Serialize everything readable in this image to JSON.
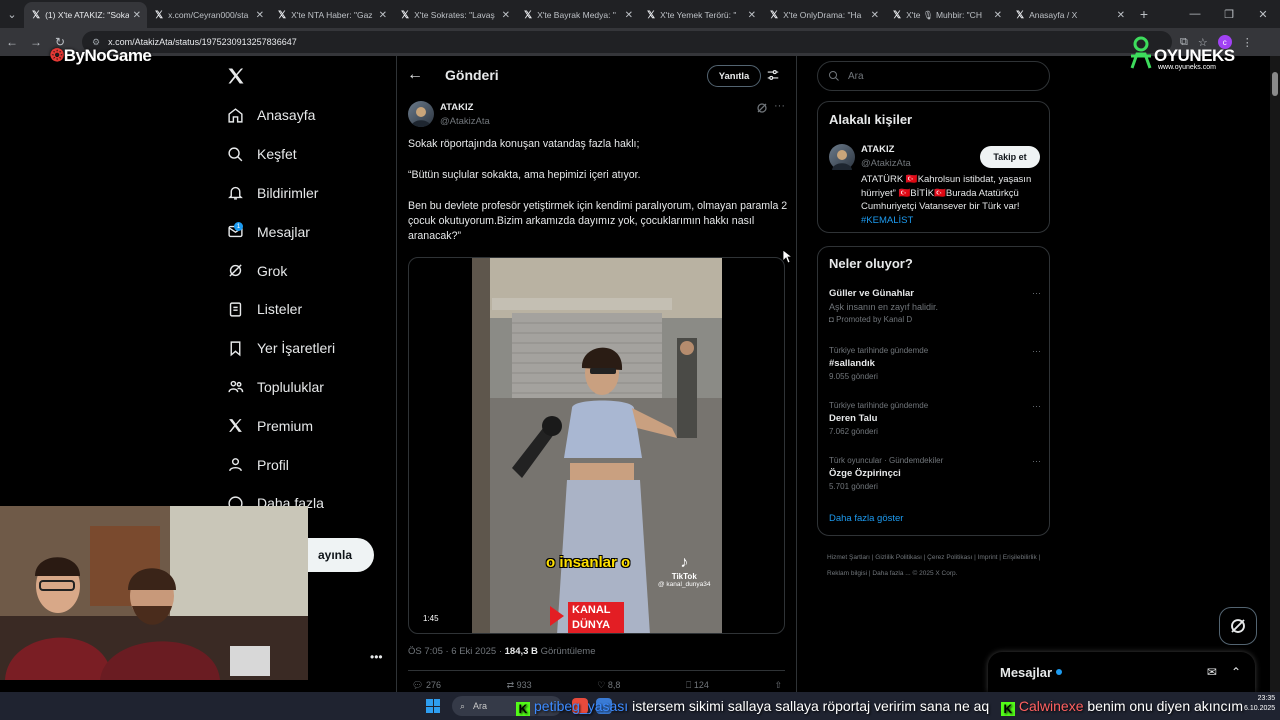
{
  "browser": {
    "tabs": [
      {
        "title": "(1) X'te ATAKIZ: \"Sokak",
        "active": true
      },
      {
        "title": "x.com/Ceyran000/sta",
        "active": false
      },
      {
        "title": "X'te NTA Haber: \"Gaz",
        "active": false
      },
      {
        "title": "X'te Sokrates: \"Lavaş",
        "active": false
      },
      {
        "title": "X'te Bayrak Medya: \"",
        "active": false
      },
      {
        "title": "X'te Yemek Terörü: \"",
        "active": false
      },
      {
        "title": "X'te OnlyDrama: \"Ha",
        "active": false
      },
      {
        "title": "X'te 🎙 Muhbir: \"CH",
        "active": false
      },
      {
        "title": "Anasayfa / X",
        "active": false
      }
    ],
    "url": "x.com/AtakizAta/status/1975230913257836647"
  },
  "overlays": {
    "bynogame": "ByNoGame",
    "oyuneks_name": "OYUNEKS",
    "oyuneks_site": "www.oyuneks.com"
  },
  "nav": {
    "items": [
      {
        "label": "Anasayfa",
        "icon": "home-icon"
      },
      {
        "label": "Keşfet",
        "icon": "search-icon"
      },
      {
        "label": "Bildirimler",
        "icon": "bell-icon"
      },
      {
        "label": "Mesajlar",
        "icon": "mail-icon"
      },
      {
        "label": "Grok",
        "icon": "grok-icon"
      },
      {
        "label": "Listeler",
        "icon": "list-icon"
      },
      {
        "label": "Yer İşaretleri",
        "icon": "bookmark-icon"
      },
      {
        "label": "Topluluklar",
        "icon": "communities-icon"
      },
      {
        "label": "Premium",
        "icon": "x-icon"
      },
      {
        "label": "Profil",
        "icon": "person-icon"
      },
      {
        "label": "Daha fazla",
        "icon": "more-circle-icon"
      }
    ],
    "messages_badge": "1",
    "post_button": "ayınla"
  },
  "post": {
    "header_title": "Gönderi",
    "reply_button": "Yanıtla",
    "author_name": "ATAKIZ",
    "author_handle": "@AtakizAta",
    "paragraphs": [
      "Sokak röportajında konuşan vatandaş fazla haklı;",
      "“Bütün suçlular sokakta, ama hepimizi içeri atıyor.",
      "Ben bu devlete profesör yetiştirmek için kendimi paralıyorum, olmayan paramla 2 çocuk okutuyorum.Bizim arkamızda dayımız yok, çocuklarımın hakkı nasıl aranacak?”"
    ],
    "video": {
      "duration": "1:45",
      "caption": "o insanlar o",
      "tiktok_label": "TikTok",
      "tiktok_user": "@ kanal_dunya34",
      "channel_logo_top": "KANAL",
      "channel_logo_bottom": "DÜNYA"
    },
    "time": "ÖS 7:05 · 6 Eki 2025 ·",
    "views_value": "184,3 B",
    "views_label": "Görüntüleme",
    "actions": {
      "replies": "276",
      "reposts": "933",
      "likes": "8,8",
      "bookmarks": "124"
    }
  },
  "right": {
    "search_placeholder": "Ara",
    "related_title": "Alakalı kişiler",
    "related_person": {
      "name": "ATAKIZ",
      "handle": "@AtakizAta",
      "follow_label": "Takip et",
      "bio": "ATATÜRK 🇹🇷Kahrolsun istibdat, yaşasın hürriyet” 🇹🇷BİTİK🇹🇷Burada Atatürkçü Cumhuriyetçi Vatansever bir Türk var!",
      "bio_tag": "#KEMALİST"
    },
    "trends_title": "Neler oluyor?",
    "trends": [
      {
        "context": "",
        "title": "Güller ve Günahlar",
        "subtitle": "Aşk insanın en zayıf halidir.",
        "count": "Promoted by Kanal D"
      },
      {
        "context": "Türkiye tarihinde gündemde",
        "title": "#sallandık",
        "subtitle": "",
        "count": "9.055 gönderi"
      },
      {
        "context": "Türkiye tarihinde gündemde",
        "title": "Deren Talu",
        "subtitle": "",
        "count": "7.062 gönderi"
      },
      {
        "context": "Türk oyuncular · Gündemdekiler",
        "title": "Özge Özpirinçci",
        "subtitle": "",
        "count": "5.701 gönderi"
      }
    ],
    "show_more": "Daha fazla göster",
    "footer": "Hizmet Şartları  |  Gizlilik Politikası  |  Çerez Politikası  |  Imprint  |  Erişilebilirlik  |  Reklam bilgisi  |  Daha fazla ...  © 2025 X Corp.",
    "messages_dock": "Mesajlar"
  },
  "taskbar": {
    "search": "Ara",
    "time": "23:35",
    "date": "6.10.2025"
  },
  "ticker": {
    "user1": "petibeg_yasası",
    "msg1": "istersem sikimi sallaya sallaya röportaj veririm sana ne aq",
    "user2": "Calwinexe",
    "msg2": "benim onu diyen akıncım"
  },
  "colors": {
    "accent": "#1d9bf0",
    "background": "#000000",
    "text": "#e7e9ea",
    "muted": "#71767b",
    "border": "#2f3336"
  }
}
